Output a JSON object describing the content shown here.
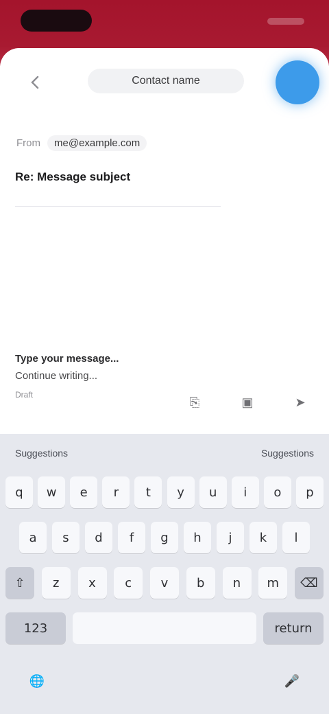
{
  "status_bar": {
    "time": "",
    "signal": ""
  },
  "header": {
    "back_icon": "chevron-left-icon",
    "contact": "Contact name",
    "avatar_color": "#3d9bea"
  },
  "from": {
    "label": "From",
    "value": "me@example.com"
  },
  "subject": "Re: Message subject",
  "composer": {
    "line1": "Type your message...",
    "line2": "Continue writing...",
    "hint": "Draft"
  },
  "actions": [
    {
      "icon": "attachment-icon",
      "glyph": "⎘"
    },
    {
      "icon": "image-icon",
      "glyph": "▣"
    },
    {
      "icon": "send-icon",
      "glyph": "➤"
    }
  ],
  "keyboard": {
    "strip_left": "Suggestions",
    "strip_right": "Suggestions",
    "row1": [
      "q",
      "w",
      "e",
      "r",
      "t",
      "y",
      "u",
      "i",
      "o",
      "p"
    ],
    "row2": [
      "a",
      "s",
      "d",
      "f",
      "g",
      "h",
      "j",
      "k",
      "l"
    ],
    "row3": [
      "⇧",
      "z",
      "x",
      "c",
      "v",
      "b",
      "n",
      "m",
      "⌫"
    ],
    "row4": {
      "left": "123",
      "space": "",
      "right": "return"
    },
    "globe": "🌐",
    "mic": "🎤"
  }
}
